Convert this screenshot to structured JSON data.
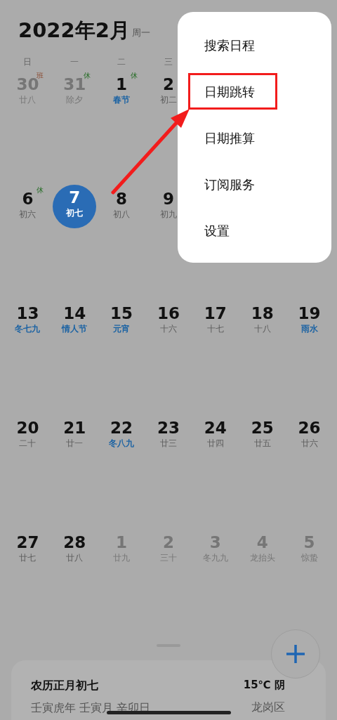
{
  "header": {
    "title": "2022年2月",
    "weekday": "周一"
  },
  "weekdays": [
    "日",
    "一",
    "二",
    "三"
  ],
  "weeks": [
    {
      "days": [
        {
          "day": "30",
          "lunar": "廿八",
          "festival": false,
          "muted": true,
          "selected": false,
          "badge": {
            "text": "班",
            "workday": true
          }
        },
        {
          "day": "31",
          "lunar": "除夕",
          "festival": false,
          "muted": true,
          "selected": false,
          "badge": {
            "text": "休",
            "workday": false
          }
        },
        {
          "day": "1",
          "lunar": "春节",
          "festival": true,
          "muted": false,
          "selected": false,
          "badge": {
            "text": "休",
            "workday": false
          }
        },
        {
          "day": "2",
          "lunar": "初二",
          "festival": false,
          "muted": false,
          "selected": false
        }
      ]
    },
    {
      "days": [
        {
          "day": "6",
          "lunar": "初六",
          "festival": false,
          "muted": false,
          "selected": false,
          "badge": {
            "text": "休",
            "workday": false
          }
        },
        {
          "day": "7",
          "lunar": "初七",
          "festival": false,
          "muted": false,
          "selected": true
        },
        {
          "day": "8",
          "lunar": "初八",
          "festival": false,
          "muted": false,
          "selected": false
        },
        {
          "day": "9",
          "lunar": "初九",
          "festival": false,
          "muted": false,
          "selected": false
        }
      ]
    },
    {
      "days": [
        {
          "day": "13",
          "lunar": "冬七九",
          "festival": true,
          "muted": false,
          "selected": false
        },
        {
          "day": "14",
          "lunar": "情人节",
          "festival": true,
          "muted": false,
          "selected": false
        },
        {
          "day": "15",
          "lunar": "元宵",
          "festival": true,
          "muted": false,
          "selected": false
        },
        {
          "day": "16",
          "lunar": "十六",
          "festival": false,
          "muted": false,
          "selected": false
        },
        {
          "day": "17",
          "lunar": "十七",
          "festival": false,
          "muted": false,
          "selected": false
        },
        {
          "day": "18",
          "lunar": "十八",
          "festival": false,
          "muted": false,
          "selected": false
        },
        {
          "day": "19",
          "lunar": "雨水",
          "festival": true,
          "muted": false,
          "selected": false
        }
      ]
    },
    {
      "days": [
        {
          "day": "20",
          "lunar": "二十",
          "festival": false,
          "muted": false,
          "selected": false
        },
        {
          "day": "21",
          "lunar": "廿一",
          "festival": false,
          "muted": false,
          "selected": false
        },
        {
          "day": "22",
          "lunar": "冬八九",
          "festival": true,
          "muted": false,
          "selected": false
        },
        {
          "day": "23",
          "lunar": "廿三",
          "festival": false,
          "muted": false,
          "selected": false
        },
        {
          "day": "24",
          "lunar": "廿四",
          "festival": false,
          "muted": false,
          "selected": false
        },
        {
          "day": "25",
          "lunar": "廿五",
          "festival": false,
          "muted": false,
          "selected": false
        },
        {
          "day": "26",
          "lunar": "廿六",
          "festival": false,
          "muted": false,
          "selected": false
        }
      ]
    },
    {
      "days": [
        {
          "day": "27",
          "lunar": "廿七",
          "festival": false,
          "muted": false,
          "selected": false
        },
        {
          "day": "28",
          "lunar": "廿八",
          "festival": false,
          "muted": false,
          "selected": false
        },
        {
          "day": "1",
          "lunar": "廿九",
          "festival": false,
          "muted": true,
          "selected": false
        },
        {
          "day": "2",
          "lunar": "三十",
          "festival": false,
          "muted": true,
          "selected": false
        },
        {
          "day": "3",
          "lunar": "冬九九",
          "festival": false,
          "muted": true,
          "selected": false
        },
        {
          "day": "4",
          "lunar": "龙抬头",
          "festival": false,
          "muted": true,
          "selected": false
        },
        {
          "day": "5",
          "lunar": "惊蛰",
          "festival": false,
          "muted": true,
          "selected": false
        }
      ]
    }
  ],
  "menu": {
    "items": [
      {
        "label": "搜索日程",
        "highlighted": false
      },
      {
        "label": "日期跳转",
        "highlighted": true
      },
      {
        "label": "日期推算",
        "highlighted": false
      },
      {
        "label": "订阅服务",
        "highlighted": false
      },
      {
        "label": "设置",
        "highlighted": false
      }
    ]
  },
  "info_card": {
    "lunar_date": "农历正月初七",
    "ganzhi": "壬寅虎年 壬寅月 辛卯日",
    "weather": "15℃ 阴",
    "location": "龙岗区"
  }
}
